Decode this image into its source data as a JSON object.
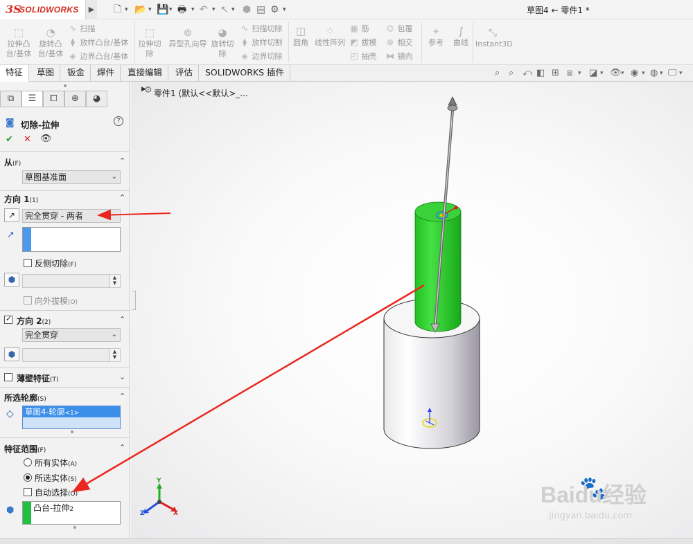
{
  "app": {
    "logo_ds": "3S",
    "logo_text": "SOLIDWORKS",
    "document_title": "草图4 ← 零件1 *"
  },
  "ribbon": {
    "extrude_boss": "拉伸凸台/基体",
    "revolve_boss": "旋转凸台/基体",
    "sweep": "扫描",
    "loft_boss": "放样凸台/基体",
    "boundary_boss": "边界凸台/基体",
    "extrude_cut": "拉伸切除",
    "hole_wizard": "异型孔向导",
    "revolve_cut": "旋转切除",
    "swept_cut": "扫描切除",
    "lofted_cut": "放样切割",
    "boundary_cut": "边界切除",
    "fillet": "圆角",
    "linear_pattern": "线性阵列",
    "rib": "筋",
    "draft": "拔模",
    "shell": "抽壳",
    "wrap": "包覆",
    "intersect": "相交",
    "mirror": "镜向",
    "reference": "参考",
    "curves": "曲线",
    "instant3d": "Instant3D"
  },
  "tabs": [
    "特征",
    "草图",
    "钣金",
    "焊件",
    "直接编辑",
    "评估",
    "SOLIDWORKS 插件"
  ],
  "feature_tree": {
    "part_label": "零件1 (默认<<默认>_..."
  },
  "property_manager": {
    "title": "切除-拉伸",
    "help": "?",
    "from": {
      "title": "从",
      "hotkey": "(F)",
      "value": "草图基准面"
    },
    "direction1": {
      "title": "方向 1",
      "hotkey": "(1)",
      "end_condition": "完全贯穿 - 两者",
      "flip_side_label": "反侧切除",
      "flip_side_hotkey": "(F)",
      "draft_outward_label": "向外拔模",
      "draft_outward_hotkey": "(O)"
    },
    "direction2": {
      "title": "方向 2",
      "hotkey": "(2)",
      "end_condition": "完全贯穿"
    },
    "thin_feature": {
      "title": "薄壁特征",
      "hotkey": "(T)"
    },
    "selected_contours": {
      "title": "所选轮廓",
      "hotkey": "(S)",
      "item": "草图4-轮廓",
      "item_suffix": "<1>"
    },
    "feature_scope": {
      "title": "特征范围",
      "hotkey": "(F)",
      "all_bodies": "所有实体",
      "all_bodies_hotkey": "(A)",
      "selected_bodies": "所选实体",
      "selected_bodies_hotkey": "(S)",
      "auto_select": "自动选择",
      "auto_select_hotkey": "(O)",
      "body_item": "凸台-拉伸",
      "body_item_suffix": "2"
    }
  },
  "triad": {
    "x": "X",
    "y": "Y",
    "z": "Z"
  },
  "watermark": {
    "brand": "Baidu经验",
    "url": "jingyan.baidu.com"
  },
  "colors": {
    "accent_red": "#d52b1e",
    "green_cylinder": "#22cc22",
    "selection_blue": "#3399ff",
    "annotation_arrow": "#e8271e"
  }
}
